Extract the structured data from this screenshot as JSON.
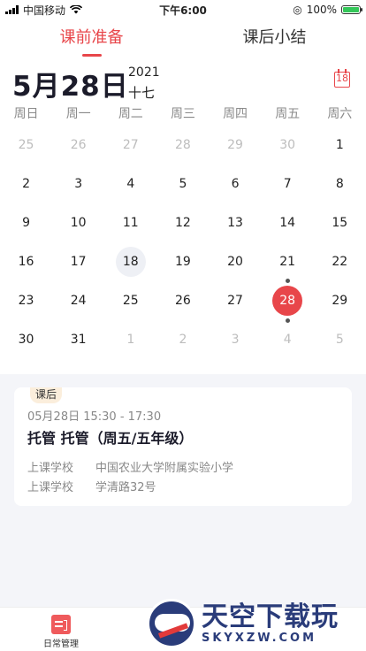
{
  "status_bar": {
    "carrier": "中国移动",
    "time": "下午6:00",
    "battery": "100%"
  },
  "tabs": [
    {
      "label": "课前准备",
      "active": true
    },
    {
      "label": "课后小结",
      "active": false
    }
  ],
  "calendar": {
    "date_title": "5月28日",
    "year": "2021",
    "lunar": "十七",
    "today_icon_text": "18",
    "weekdays": [
      "周日",
      "周一",
      "周二",
      "周三",
      "周四",
      "周五",
      "周六"
    ],
    "weeks": [
      [
        "25",
        "26",
        "27",
        "28",
        "29",
        "30",
        "1"
      ],
      [
        "2",
        "3",
        "4",
        "5",
        "6",
        "7",
        "8"
      ],
      [
        "9",
        "10",
        "11",
        "12",
        "13",
        "14",
        "15"
      ],
      [
        "16",
        "17",
        "18",
        "19",
        "20",
        "21",
        "22"
      ],
      [
        "23",
        "24",
        "25",
        "26",
        "27",
        "28",
        "29"
      ],
      [
        "30",
        "31",
        "1",
        "2",
        "3",
        "4",
        "5"
      ]
    ]
  },
  "lesson_card": {
    "tag": "课后",
    "time": "05月28日 15:30 - 17:30",
    "title": "托管 托管（周五/五年级）",
    "school_label": "上课学校",
    "school_value": "中国农业大学附属实验小学",
    "address_label": "上课学校",
    "address_value": "学清路32号"
  },
  "bottom_nav": {
    "item_label": "日常管理"
  },
  "watermark": {
    "cn": "天空下载玩",
    "en": "SKYXZW.COM"
  },
  "colors": {
    "accent": "#e8464a",
    "dim_text": "#bdbdbd",
    "today_bg": "#eef0f5"
  }
}
